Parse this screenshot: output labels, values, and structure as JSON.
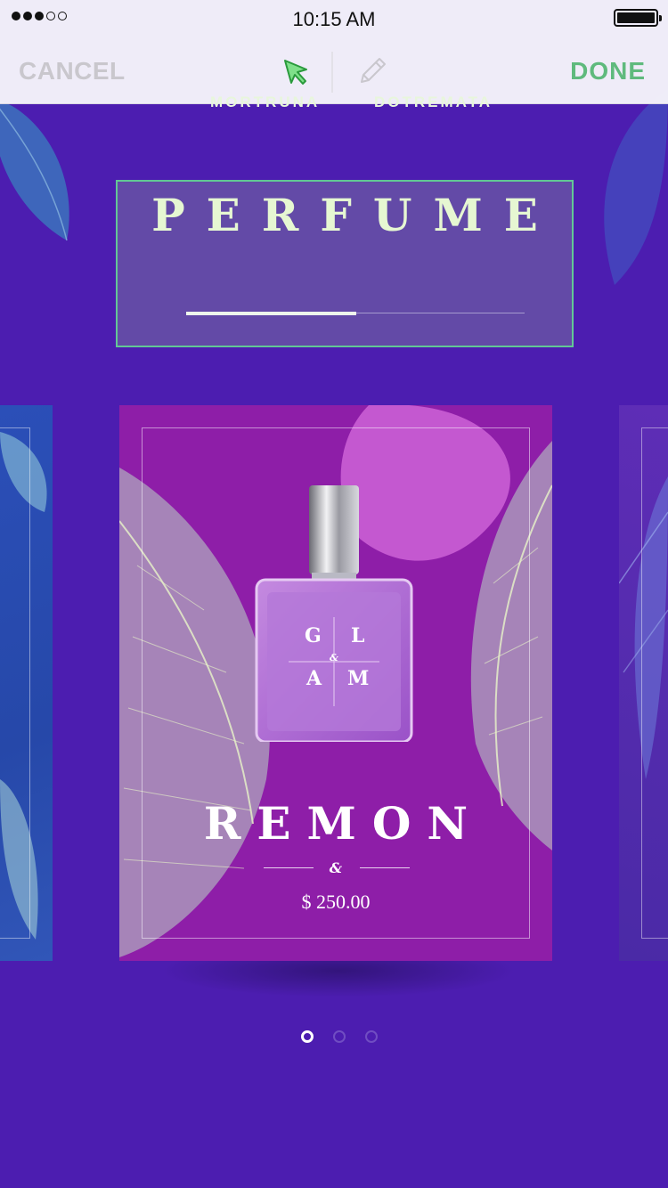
{
  "status_bar": {
    "time": "10:15 AM",
    "signal_bars_filled": 3,
    "signal_bars_total": 5,
    "battery_level": 1.0
  },
  "toolbar": {
    "cancel_label": "CANCEL",
    "done_label": "DONE",
    "select_icon": "cursor-arrow-icon",
    "edit_icon": "pencil-icon",
    "accent_color": "#5fba7d"
  },
  "header": {
    "title": "PERFUME",
    "tabs": [
      {
        "label": "MORTRUNA",
        "active": true
      },
      {
        "label": "DOTREMATA",
        "active": false
      }
    ]
  },
  "product": {
    "bottle_monogram": [
      "G",
      "L",
      "&",
      "A",
      "M"
    ],
    "name": "REMON",
    "ampersand": "&",
    "price": "$ 250.00",
    "background_color": "#8e1ea8"
  },
  "carousel": {
    "page_count": 3,
    "active_page": 1
  },
  "colors": {
    "background": "#4c1db0",
    "header_border": "#62c796",
    "title_text": "#e6f7d2"
  }
}
